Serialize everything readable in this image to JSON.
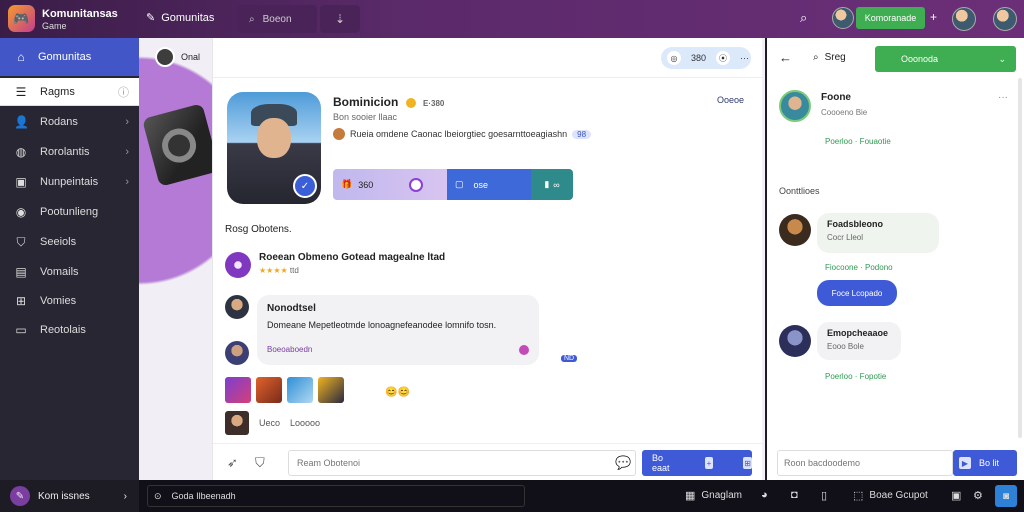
{
  "topbar": {
    "brand_title": "Komunitansas",
    "brand_sub": "Game",
    "community_label": "Gomunitas",
    "search_label": "Boeon",
    "green_button": "Komoranade",
    "plus": "+"
  },
  "sidebar": {
    "active": "Gomunitas",
    "items": [
      {
        "label": "Ragms",
        "icon": "list-icon"
      },
      {
        "label": "Rodans",
        "icon": "user-icon"
      },
      {
        "label": "Rorolantis",
        "icon": "globe-icon"
      },
      {
        "label": "Nunpeintais",
        "icon": "box-icon"
      },
      {
        "label": "Pootunlieng",
        "icon": "user-icon"
      },
      {
        "label": "Seeiols",
        "icon": "shield-icon"
      },
      {
        "label": "Vomails",
        "icon": "chart-icon"
      },
      {
        "label": "Vomies",
        "icon": "grid-icon"
      },
      {
        "label": "Reotolais",
        "icon": "bar-icon"
      }
    ],
    "bottom_label": "Kom issnes"
  },
  "deco": {
    "label": "Onal"
  },
  "main": {
    "header_pill": {
      "count": "380"
    },
    "profile": {
      "name": "Bominicion",
      "badge": "E·380",
      "subtitle": "Bon sooier llaac",
      "description": "Rueia omdene Caonac lbeiorgtiec goesarnttoeagiashn",
      "tag": "98",
      "more": "Ooeoe"
    },
    "stats": {
      "a": "360",
      "b": "ose"
    },
    "section_title": "Rosg Obotens.",
    "post": {
      "title": "Roeean Obmeno Gotead magealne ltad",
      "meta_stars": "★★★★",
      "meta_text": "ttd"
    },
    "chat": {
      "title": "Nonodtsel",
      "text": "Domeane Mepetleotmde lonoagnefeanodee lomnifo tosn.",
      "link": "Boeoaboedn",
      "reply": "ND"
    },
    "emoji_chip": "😊😊",
    "foot_text_a": "Ueco",
    "foot_text_b": "Looooo",
    "composer": {
      "placeholder": "Ream Obotenoi",
      "send_label": "Bo eaat"
    }
  },
  "right": {
    "search_label": "Sreg",
    "green_button": "Ooonoda",
    "profile_name": "Foone",
    "profile_sub": "Coooeno Bie",
    "more": "···",
    "link_1": "Poerloo · Fouaotie",
    "section_title": "Oonttlioes",
    "msg1_title": "Foadsbleono",
    "msg1_sub": "Cocr Lleol",
    "link_2": "Fiocoone · Podono",
    "blue_bubble": "Foce Lcopado",
    "msg2_title": "Emopcheaaoe",
    "msg2_sub": "Eooo Bole",
    "link_3": "Poerloo · Fopotie",
    "input_placeholder": "Roon bacdoodemo",
    "send_label": "Bo lit"
  },
  "bottombar": {
    "search_label": "Goda Ilbeenadh",
    "item_1": "Gnaglam",
    "item_2": "Boae Gcupot"
  }
}
